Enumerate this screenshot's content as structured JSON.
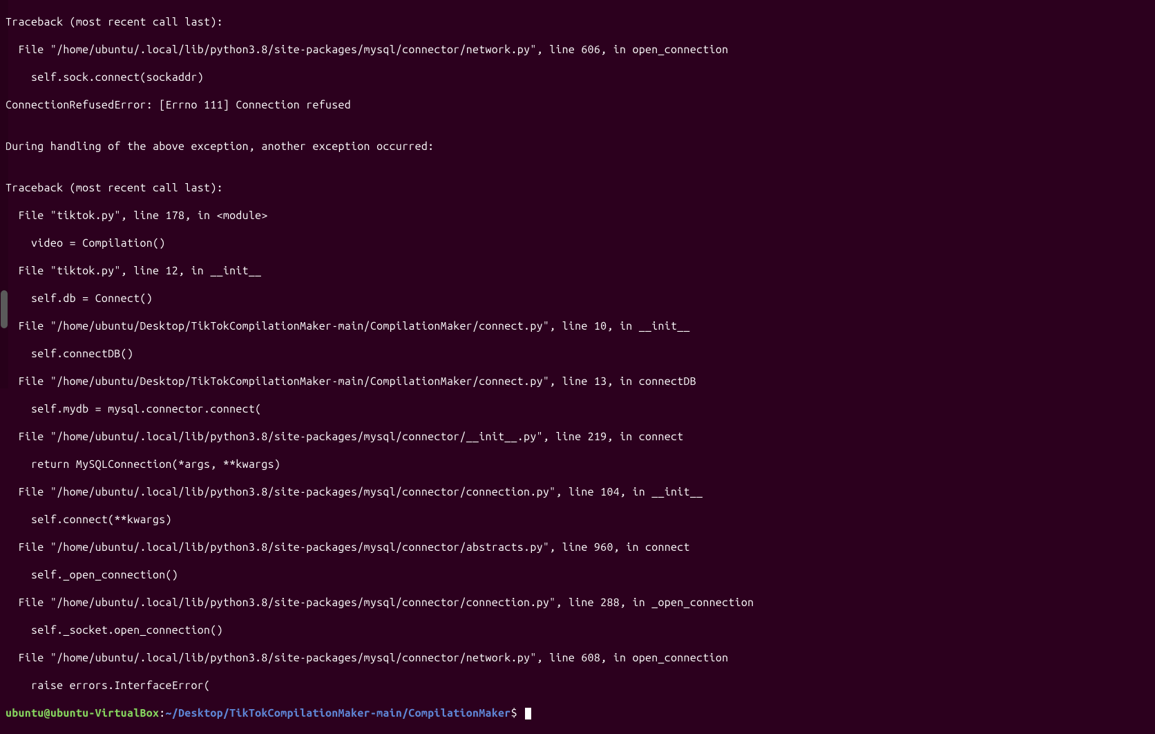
{
  "terminal": {
    "lines": [
      "Traceback (most recent call last):",
      "  File \"/home/ubuntu/.local/lib/python3.8/site-packages/mysql/connector/network.py\", line 606, in open_connection",
      "    self.sock.connect(sockaddr)",
      "ConnectionRefusedError: [Errno 111] Connection refused",
      "",
      "During handling of the above exception, another exception occurred:",
      "",
      "Traceback (most recent call last):",
      "  File \"tiktok.py\", line 178, in <module>",
      "    video = Compilation()",
      "  File \"tiktok.py\", line 12, in __init__",
      "    self.db = Connect()",
      "  File \"/home/ubuntu/Desktop/TikTokCompilationMaker-main/CompilationMaker/connect.py\", line 10, in __init__",
      "    self.connectDB()",
      "  File \"/home/ubuntu/Desktop/TikTokCompilationMaker-main/CompilationMaker/connect.py\", line 13, in connectDB",
      "    self.mydb = mysql.connector.connect(",
      "  File \"/home/ubuntu/.local/lib/python3.8/site-packages/mysql/connector/__init__.py\", line 219, in connect",
      "    return MySQLConnection(*args, **kwargs)",
      "  File \"/home/ubuntu/.local/lib/python3.8/site-packages/mysql/connector/connection.py\", line 104, in __init__",
      "    self.connect(**kwargs)",
      "  File \"/home/ubuntu/.local/lib/python3.8/site-packages/mysql/connector/abstracts.py\", line 960, in connect",
      "    self._open_connection()",
      "  File \"/home/ubuntu/.local/lib/python3.8/site-packages/mysql/connector/connection.py\", line 288, in _open_connection",
      "    self._socket.open_connection()",
      "  File \"/home/ubuntu/.local/lib/python3.8/site-packages/mysql/connector/network.py\", line 608, in open_connection",
      "    raise errors.InterfaceError("
    ],
    "prompt": {
      "user_host": "ubuntu@ubuntu-VirtualBox",
      "colon": ":",
      "path": "~/Desktop/TikTokCompilationMaker-main/CompilationMaker",
      "dollar": "$ "
    }
  }
}
